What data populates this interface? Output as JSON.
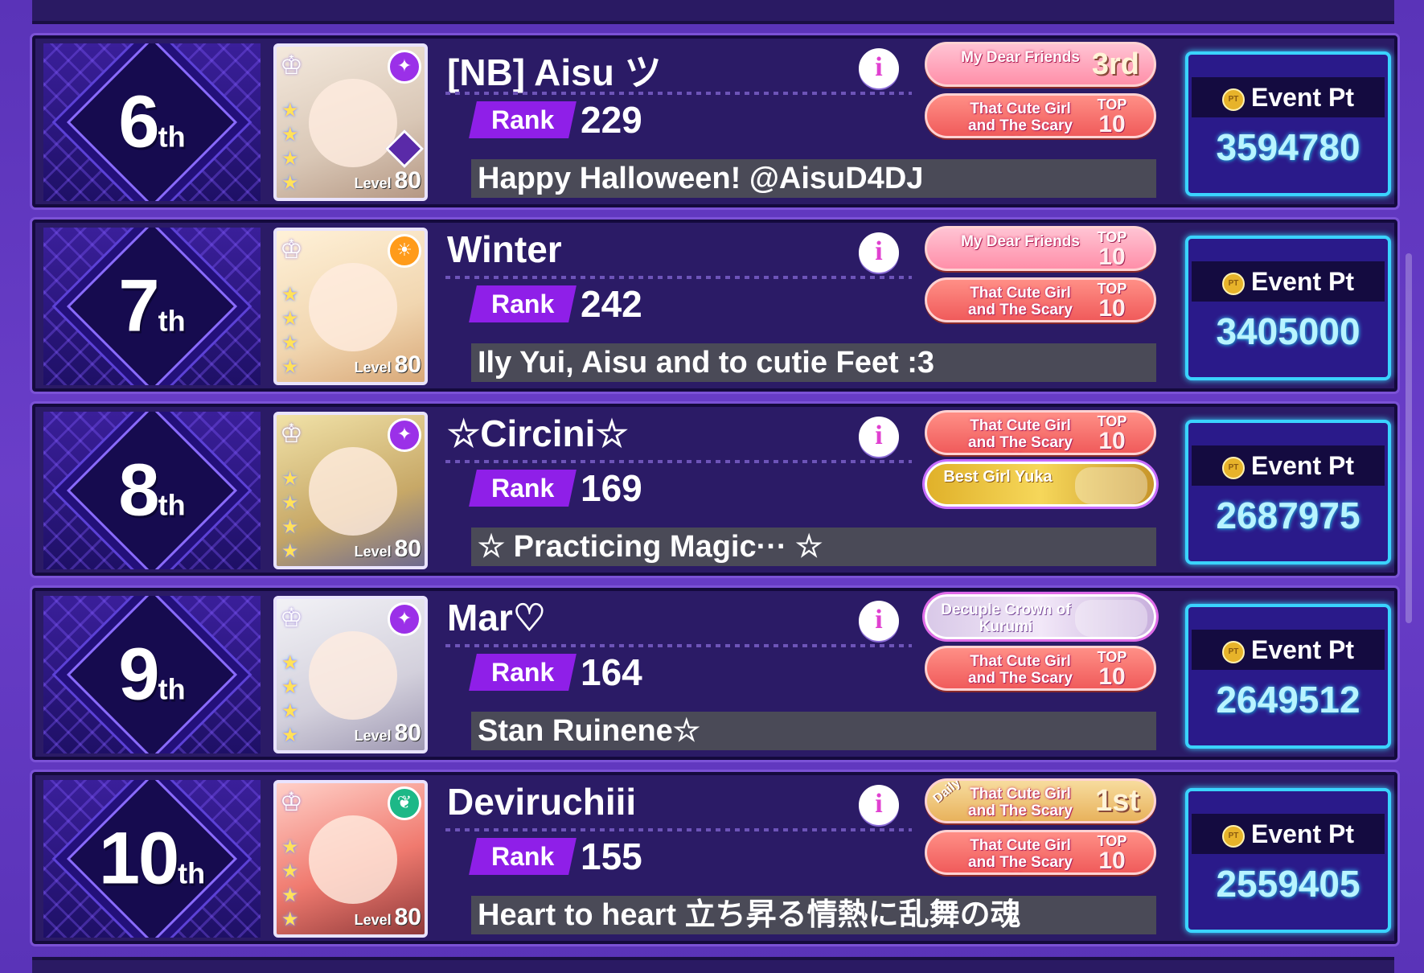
{
  "event_pt_label": "Event Pt",
  "rank_label": "Rank",
  "level_label": "Level",
  "entries": [
    {
      "place": "6",
      "suffix": "th",
      "name": "[NB] Aisu ツ",
      "rank": "229",
      "comment": "Happy Halloween! @AisuD4DJ",
      "level": "80",
      "event_pt": "3594780",
      "badges": [
        {
          "title": "My Dear Friends",
          "place": "3rd",
          "top": "",
          "style": "pinkish"
        },
        {
          "title": "That Cute Girl and The Scary Me",
          "top_label": "TOP",
          "top": "10",
          "style": "red"
        }
      ]
    },
    {
      "place": "7",
      "suffix": "th",
      "name": "Winter",
      "rank": "242",
      "comment": "Ily Yui, Aisu and to cutie Feet :3",
      "level": "80",
      "event_pt": "3405000",
      "badges": [
        {
          "title": "My Dear Friends",
          "top_label": "TOP",
          "top": "10",
          "style": "pinkish"
        },
        {
          "title": "That Cute Girl and The Scary Me",
          "top_label": "TOP",
          "top": "10",
          "style": "red"
        }
      ]
    },
    {
      "place": "8",
      "suffix": "th",
      "name": "☆Circini☆",
      "rank": "169",
      "comment": "☆ Practicing Magic··· ☆",
      "level": "80",
      "event_pt": "2687975",
      "badges": [
        {
          "title": "That Cute Girl and The Scary Me",
          "top_label": "TOP",
          "top": "10",
          "style": "red"
        },
        {
          "title": "Best Girl Yuka",
          "style": "gold"
        }
      ]
    },
    {
      "place": "9",
      "suffix": "th",
      "name": "Mar♡",
      "rank": "164",
      "comment": "Stan Ruinene☆",
      "level": "80",
      "event_pt": "2649512",
      "badges": [
        {
          "title": "Decuple Crown of Kurumi",
          "style": "silver"
        },
        {
          "title": "That Cute Girl and The Scary Me",
          "top_label": "TOP",
          "top": "10",
          "style": "red"
        }
      ]
    },
    {
      "place": "10",
      "suffix": "th",
      "name": "Deviruchiii",
      "rank": "155",
      "comment": "Heart to heart 立ち昇る情熱に乱舞の魂",
      "level": "80",
      "event_pt": "2559405",
      "badges": [
        {
          "daily": "Daily",
          "title": "That Cute Girl and The Scary Me",
          "place": "1st",
          "style": "dailygold"
        },
        {
          "title": "That Cute Girl and The Scary Me",
          "top_label": "TOP",
          "top": "10",
          "style": "red"
        }
      ]
    }
  ],
  "icons": {
    "info": "i",
    "star": "★",
    "rarity": "♔",
    "event_pt_coin": "PT"
  },
  "colors": {
    "background": "#5a33b8",
    "panel": "#2b1b66",
    "rank_label": "#8f1fe8",
    "event_border": "#3ad3ff"
  }
}
